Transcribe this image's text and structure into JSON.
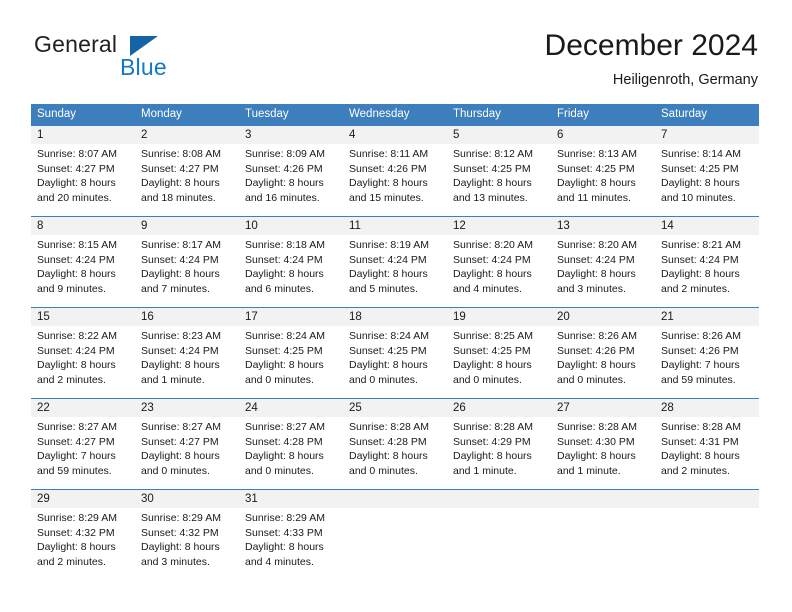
{
  "brand": {
    "name_part1": "General",
    "name_part2": "Blue",
    "triangle_color": "#1464a5",
    "blue_color": "#1479c4"
  },
  "header": {
    "title": "December 2024",
    "subtitle": "Heiligenroth, Germany"
  },
  "theme": {
    "header_bar": "#3d7ebd",
    "daynum_band": "#f2f2f2",
    "text": "#1a1a1a"
  },
  "weekday_headers": [
    "Sunday",
    "Monday",
    "Tuesday",
    "Wednesday",
    "Thursday",
    "Friday",
    "Saturday"
  ],
  "weeks": [
    {
      "days": [
        {
          "num": "1",
          "l1": "Sunrise: 8:07 AM",
          "l2": "Sunset: 4:27 PM",
          "l3": "Daylight: 8 hours",
          "l4": "and 20 minutes."
        },
        {
          "num": "2",
          "l1": "Sunrise: 8:08 AM",
          "l2": "Sunset: 4:27 PM",
          "l3": "Daylight: 8 hours",
          "l4": "and 18 minutes."
        },
        {
          "num": "3",
          "l1": "Sunrise: 8:09 AM",
          "l2": "Sunset: 4:26 PM",
          "l3": "Daylight: 8 hours",
          "l4": "and 16 minutes."
        },
        {
          "num": "4",
          "l1": "Sunrise: 8:11 AM",
          "l2": "Sunset: 4:26 PM",
          "l3": "Daylight: 8 hours",
          "l4": "and 15 minutes."
        },
        {
          "num": "5",
          "l1": "Sunrise: 8:12 AM",
          "l2": "Sunset: 4:25 PM",
          "l3": "Daylight: 8 hours",
          "l4": "and 13 minutes."
        },
        {
          "num": "6",
          "l1": "Sunrise: 8:13 AM",
          "l2": "Sunset: 4:25 PM",
          "l3": "Daylight: 8 hours",
          "l4": "and 11 minutes."
        },
        {
          "num": "7",
          "l1": "Sunrise: 8:14 AM",
          "l2": "Sunset: 4:25 PM",
          "l3": "Daylight: 8 hours",
          "l4": "and 10 minutes."
        }
      ]
    },
    {
      "days": [
        {
          "num": "8",
          "l1": "Sunrise: 8:15 AM",
          "l2": "Sunset: 4:24 PM",
          "l3": "Daylight: 8 hours",
          "l4": "and 9 minutes."
        },
        {
          "num": "9",
          "l1": "Sunrise: 8:17 AM",
          "l2": "Sunset: 4:24 PM",
          "l3": "Daylight: 8 hours",
          "l4": "and 7 minutes."
        },
        {
          "num": "10",
          "l1": "Sunrise: 8:18 AM",
          "l2": "Sunset: 4:24 PM",
          "l3": "Daylight: 8 hours",
          "l4": "and 6 minutes."
        },
        {
          "num": "11",
          "l1": "Sunrise: 8:19 AM",
          "l2": "Sunset: 4:24 PM",
          "l3": "Daylight: 8 hours",
          "l4": "and 5 minutes."
        },
        {
          "num": "12",
          "l1": "Sunrise: 8:20 AM",
          "l2": "Sunset: 4:24 PM",
          "l3": "Daylight: 8 hours",
          "l4": "and 4 minutes."
        },
        {
          "num": "13",
          "l1": "Sunrise: 8:20 AM",
          "l2": "Sunset: 4:24 PM",
          "l3": "Daylight: 8 hours",
          "l4": "and 3 minutes."
        },
        {
          "num": "14",
          "l1": "Sunrise: 8:21 AM",
          "l2": "Sunset: 4:24 PM",
          "l3": "Daylight: 8 hours",
          "l4": "and 2 minutes."
        }
      ]
    },
    {
      "days": [
        {
          "num": "15",
          "l1": "Sunrise: 8:22 AM",
          "l2": "Sunset: 4:24 PM",
          "l3": "Daylight: 8 hours",
          "l4": "and 2 minutes."
        },
        {
          "num": "16",
          "l1": "Sunrise: 8:23 AM",
          "l2": "Sunset: 4:24 PM",
          "l3": "Daylight: 8 hours",
          "l4": "and 1 minute."
        },
        {
          "num": "17",
          "l1": "Sunrise: 8:24 AM",
          "l2": "Sunset: 4:25 PM",
          "l3": "Daylight: 8 hours",
          "l4": "and 0 minutes."
        },
        {
          "num": "18",
          "l1": "Sunrise: 8:24 AM",
          "l2": "Sunset: 4:25 PM",
          "l3": "Daylight: 8 hours",
          "l4": "and 0 minutes."
        },
        {
          "num": "19",
          "l1": "Sunrise: 8:25 AM",
          "l2": "Sunset: 4:25 PM",
          "l3": "Daylight: 8 hours",
          "l4": "and 0 minutes."
        },
        {
          "num": "20",
          "l1": "Sunrise: 8:26 AM",
          "l2": "Sunset: 4:26 PM",
          "l3": "Daylight: 8 hours",
          "l4": "and 0 minutes."
        },
        {
          "num": "21",
          "l1": "Sunrise: 8:26 AM",
          "l2": "Sunset: 4:26 PM",
          "l3": "Daylight: 7 hours",
          "l4": "and 59 minutes."
        }
      ]
    },
    {
      "days": [
        {
          "num": "22",
          "l1": "Sunrise: 8:27 AM",
          "l2": "Sunset: 4:27 PM",
          "l3": "Daylight: 7 hours",
          "l4": "and 59 minutes."
        },
        {
          "num": "23",
          "l1": "Sunrise: 8:27 AM",
          "l2": "Sunset: 4:27 PM",
          "l3": "Daylight: 8 hours",
          "l4": "and 0 minutes."
        },
        {
          "num": "24",
          "l1": "Sunrise: 8:27 AM",
          "l2": "Sunset: 4:28 PM",
          "l3": "Daylight: 8 hours",
          "l4": "and 0 minutes."
        },
        {
          "num": "25",
          "l1": "Sunrise: 8:28 AM",
          "l2": "Sunset: 4:28 PM",
          "l3": "Daylight: 8 hours",
          "l4": "and 0 minutes."
        },
        {
          "num": "26",
          "l1": "Sunrise: 8:28 AM",
          "l2": "Sunset: 4:29 PM",
          "l3": "Daylight: 8 hours",
          "l4": "and 1 minute."
        },
        {
          "num": "27",
          "l1": "Sunrise: 8:28 AM",
          "l2": "Sunset: 4:30 PM",
          "l3": "Daylight: 8 hours",
          "l4": "and 1 minute."
        },
        {
          "num": "28",
          "l1": "Sunrise: 8:28 AM",
          "l2": "Sunset: 4:31 PM",
          "l3": "Daylight: 8 hours",
          "l4": "and 2 minutes."
        }
      ]
    },
    {
      "days": [
        {
          "num": "29",
          "l1": "Sunrise: 8:29 AM",
          "l2": "Sunset: 4:32 PM",
          "l3": "Daylight: 8 hours",
          "l4": "and 2 minutes."
        },
        {
          "num": "30",
          "l1": "Sunrise: 8:29 AM",
          "l2": "Sunset: 4:32 PM",
          "l3": "Daylight: 8 hours",
          "l4": "and 3 minutes."
        },
        {
          "num": "31",
          "l1": "Sunrise: 8:29 AM",
          "l2": "Sunset: 4:33 PM",
          "l3": "Daylight: 8 hours",
          "l4": "and 4 minutes."
        },
        {
          "num": "",
          "l1": "",
          "l2": "",
          "l3": "",
          "l4": ""
        },
        {
          "num": "",
          "l1": "",
          "l2": "",
          "l3": "",
          "l4": ""
        },
        {
          "num": "",
          "l1": "",
          "l2": "",
          "l3": "",
          "l4": ""
        },
        {
          "num": "",
          "l1": "",
          "l2": "",
          "l3": "",
          "l4": ""
        }
      ]
    }
  ]
}
